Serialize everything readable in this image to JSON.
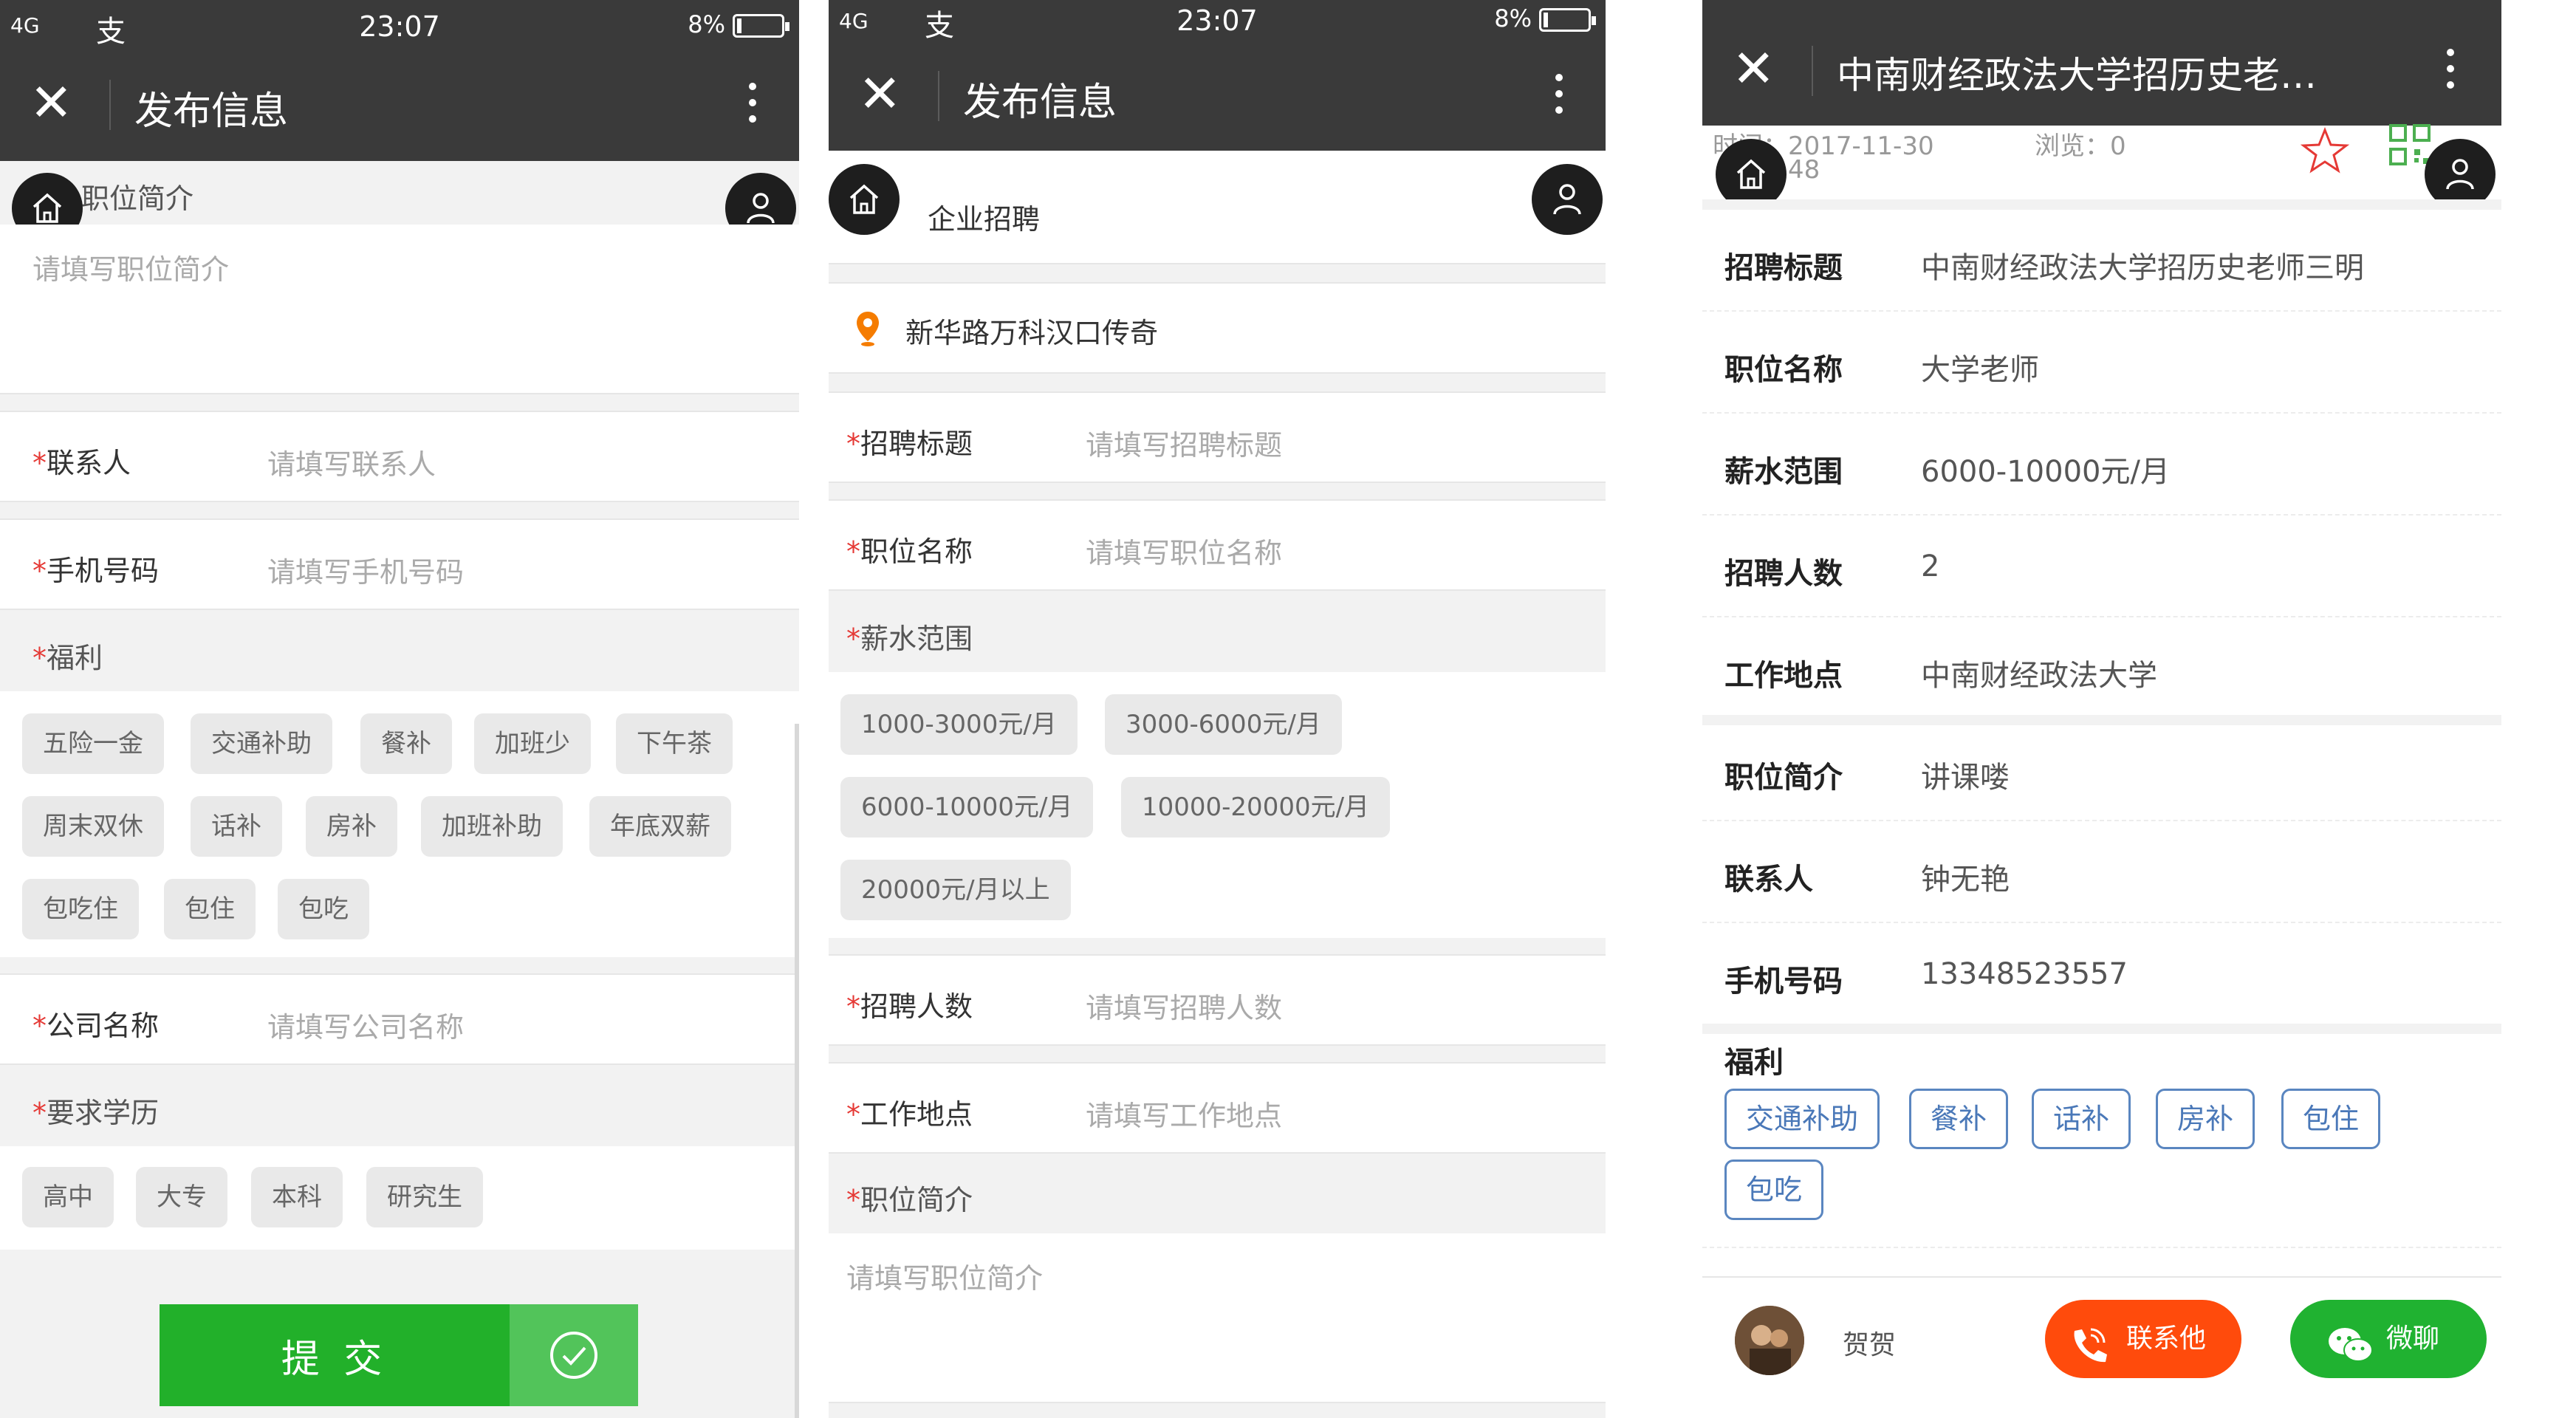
{
  "status": {
    "network": "4G",
    "time": "23:07",
    "battery": "8%",
    "glyphs": "支"
  },
  "titlebar": {
    "title": "发布信息",
    "close_icon": "close-icon",
    "more_icon": "more-icon"
  },
  "panel1": {
    "top_section_label": "职位简介",
    "intro_placeholder": "请填写职位简介",
    "contact": {
      "label": "联系人",
      "placeholder": "请填写联系人"
    },
    "phone": {
      "label": "手机号码",
      "placeholder": "请填写手机号码"
    },
    "benefits_label": "福利",
    "benefits": [
      "五险一金",
      "交通补助",
      "餐补",
      "加班少",
      "下午茶",
      "周末双休",
      "话补",
      "房补",
      "加班补助",
      "年底双薪",
      "包吃住",
      "包住",
      "包吃"
    ],
    "company": {
      "label": "公司名称",
      "placeholder": "请填写公司名称"
    },
    "education_label": "要求学历",
    "education": [
      "高中",
      "大专",
      "本科",
      "研究生"
    ],
    "submit_label": "提 交"
  },
  "panel2": {
    "category": "企业招聘",
    "location": "新华路万科汉口传奇",
    "title_field": {
      "label": "招聘标题",
      "placeholder": "请填写招聘标题"
    },
    "position_field": {
      "label": "职位名称",
      "placeholder": "请填写职位名称"
    },
    "salary_label": "薪水范围",
    "salaries": [
      "1000-3000元/月",
      "3000-6000元/月",
      "6000-10000元/月",
      "10000-20000元/月",
      "20000元/月以上"
    ],
    "count_field": {
      "label": "招聘人数",
      "placeholder": "请填写招聘人数"
    },
    "place_field": {
      "label": "工作地点",
      "placeholder": "请填写工作地点"
    },
    "intro_label": "职位简介",
    "intro_placeholder": "请填写职位简介"
  },
  "panel3": {
    "title": "中南财经政法大学招历史老…",
    "meta_time_label": "时间：",
    "meta_time": "2017-11-30",
    "meta_time2": "48",
    "meta_views": "浏览：0",
    "rows": [
      {
        "k": "招聘标题",
        "v": "中南财经政法大学招历史老师三明"
      },
      {
        "k": "职位名称",
        "v": "大学老师"
      },
      {
        "k": "薪水范围",
        "v": "6000-10000元/月"
      },
      {
        "k": "招聘人数",
        "v": "2"
      },
      {
        "k": "工作地点",
        "v": "中南财经政法大学"
      },
      {
        "k": "职位简介",
        "v": "讲课喽"
      },
      {
        "k": "联系人",
        "v": "钟无艳"
      },
      {
        "k": "手机号码",
        "v": "13348523557"
      }
    ],
    "benefits_label": "福利",
    "benefits": [
      "交通补助",
      "餐补",
      "话补",
      "房补",
      "包住",
      "包吃"
    ],
    "user_name": "贺贺",
    "call_label": "联系他",
    "chat_label": "微聊"
  },
  "colors": {
    "bar": "#3a3a3a",
    "submit": "#22b02a",
    "call": "#ff4b0c",
    "chat": "#20b231",
    "tag": "#4a78b8"
  }
}
